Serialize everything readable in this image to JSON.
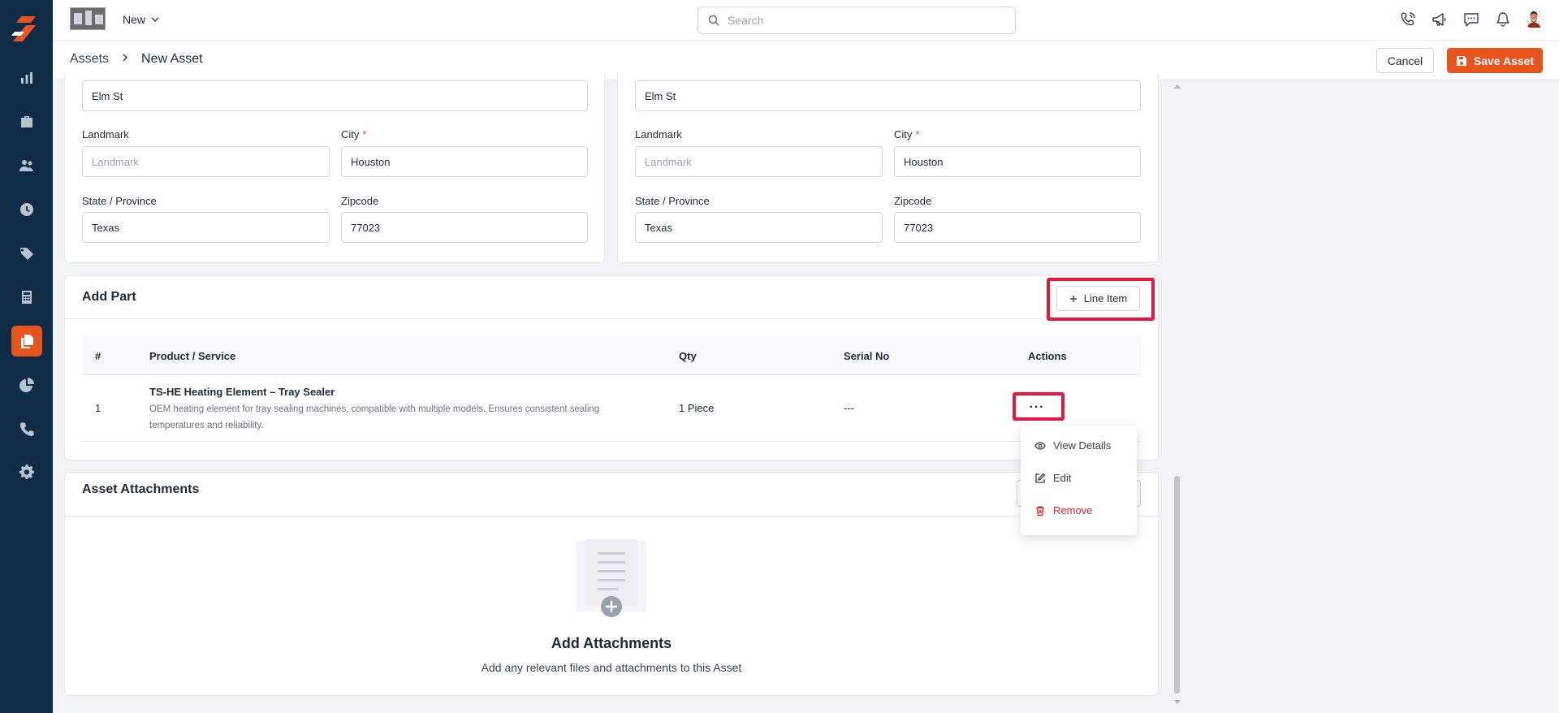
{
  "app": {
    "new_label": "New",
    "search_placeholder": "Search"
  },
  "header": {
    "breadcrumb_root": "Assets",
    "breadcrumb_current": "New Asset",
    "cancel_label": "Cancel",
    "save_label": "Save Asset"
  },
  "address_left": {
    "street_value": "Elm St",
    "landmark_label": "Landmark",
    "landmark_placeholder": "Landmark",
    "city_label": "City",
    "city_value": "Houston",
    "state_label": "State / Province",
    "state_value": "Texas",
    "zip_label": "Zipcode",
    "zip_value": "77023"
  },
  "address_right": {
    "street_value": "Elm St",
    "landmark_label": "Landmark",
    "landmark_placeholder": "Landmark",
    "city_label": "City",
    "city_value": "Houston",
    "state_label": "State / Province",
    "state_value": "Texas",
    "zip_label": "Zipcode",
    "zip_value": "77023"
  },
  "required_mark": "*",
  "parts": {
    "title": "Add Part",
    "line_item_label": "Line Item",
    "columns": [
      "#",
      "Product / Service",
      "Qty",
      "Serial No",
      "Actions"
    ],
    "rows": [
      {
        "index": "1",
        "name": "TS-HE Heating Element – Tray Sealer",
        "description": "OEM heating element for tray sealing machines, compatible with multiple models. Ensures consistent sealing temperatures and reliability.",
        "qty": "1 Piece",
        "serial": "---",
        "actions": "···"
      }
    ],
    "menu": {
      "view": "View Details",
      "edit": "Edit",
      "remove": "Remove"
    }
  },
  "attachments": {
    "title": "Asset Attachments",
    "empty_title": "Add Attachments",
    "empty_subtitle": "Add any relevant files and attachments to this Asset"
  },
  "colors": {
    "brand": "#e8541e",
    "sidebar": "#0f2b45",
    "highlight": "#e5173f"
  },
  "icons": [
    "logo-icon",
    "chart-icon",
    "briefcase-icon",
    "users-icon",
    "clock-icon",
    "tag-icon",
    "calculator-icon",
    "documents-icon",
    "pie-chart-icon",
    "phone-icon",
    "gear-icon",
    "search-icon",
    "phone-call-icon",
    "megaphone-icon",
    "chat-icon",
    "bell-icon"
  ]
}
